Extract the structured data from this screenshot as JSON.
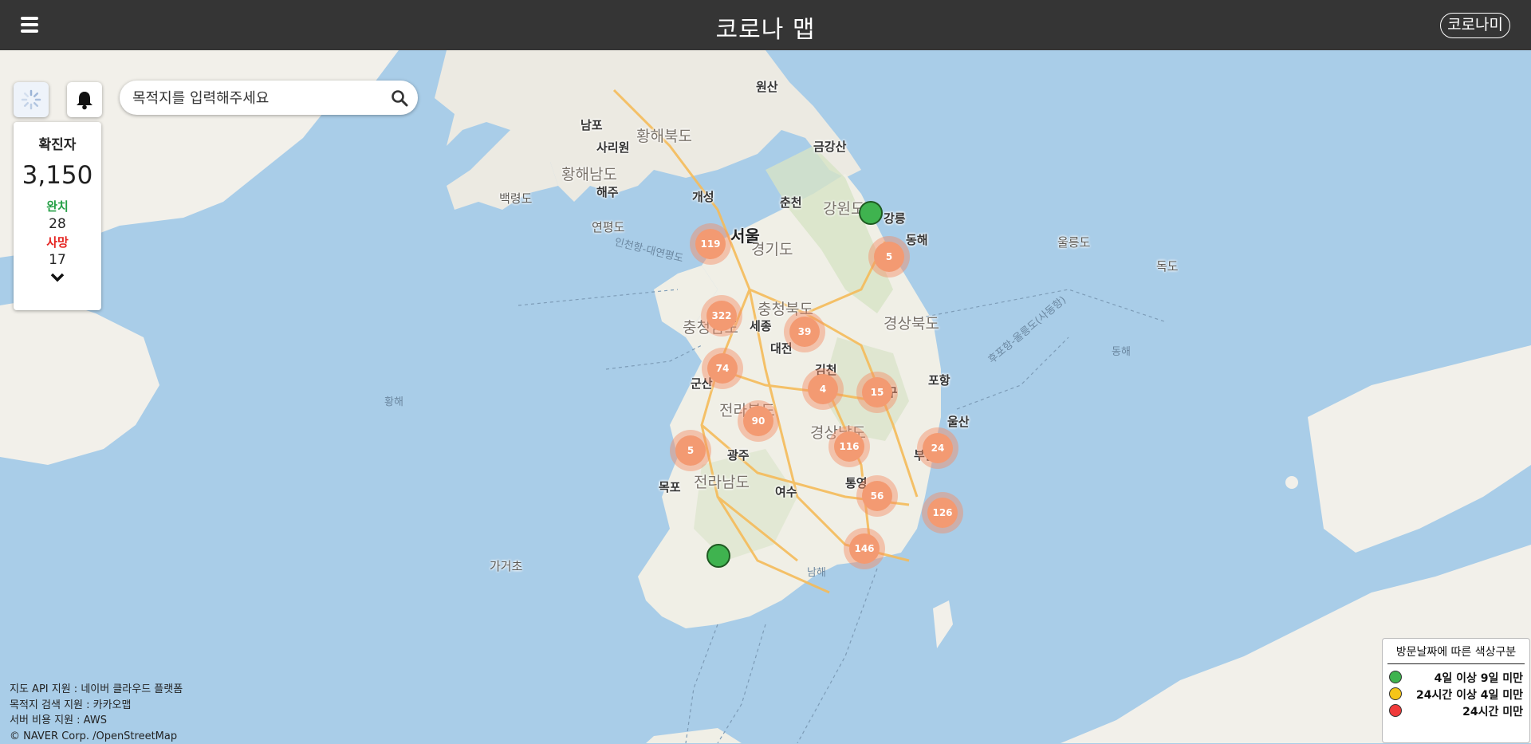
{
  "header": {
    "title": "코로나 맵",
    "brand_button": "코로나미"
  },
  "search": {
    "placeholder": "목적지를 입력해주세요"
  },
  "stats": {
    "confirmed_label": "확진자",
    "confirmed": "3,150",
    "recovered_label": "완치",
    "recovered": "28",
    "deaths_label": "사망",
    "deaths": "17"
  },
  "map": {
    "places": [
      "원산",
      "남포",
      "황해북도",
      "사리원",
      "황해남도",
      "해주",
      "금강산",
      "개성",
      "백령도",
      "연평도",
      "춘천",
      "강원도",
      "강릉",
      "동해",
      "울릉도",
      "독도",
      "서울",
      "인천",
      "경기도",
      "인천항-대연평도",
      "충청북도",
      "충청남도",
      "세종",
      "대전",
      "경상북도",
      "김천",
      "포항",
      "군산",
      "대구",
      "전라북도",
      "경상남도",
      "울산",
      "광주",
      "부산",
      "전라남도",
      "목포",
      "여수",
      "통영",
      "후포항-울릉도(사동항)",
      "황해",
      "동해",
      "가거초",
      "남해"
    ],
    "clusters": [
      "119",
      "5",
      "322",
      "39",
      "74",
      "4",
      "15",
      "90",
      "116",
      "24",
      "5",
      "56",
      "126",
      "146"
    ]
  },
  "attribution": [
    "지도 API 지원 : 네이버 클라우드 플랫폼",
    "목적지 검색 지원 : 카카오맵",
    "서버 비용 지원 : AWS",
    "© NAVER Corp. /OpenStreetMap"
  ],
  "legend": {
    "title": "방문날짜에 따른 색상구분",
    "items": [
      {
        "label": "4일 이상 9일 미만",
        "color": "#3fb34f"
      },
      {
        "label": "24시간 이상 4일 미만",
        "color": "#f5c518"
      },
      {
        "label": "24시간 미만",
        "color": "#f03a3a"
      }
    ]
  },
  "icons": [
    "hamburger-menu-icon",
    "location-spinner-icon",
    "bell-icon",
    "search-icon",
    "chevron-down-icon"
  ]
}
